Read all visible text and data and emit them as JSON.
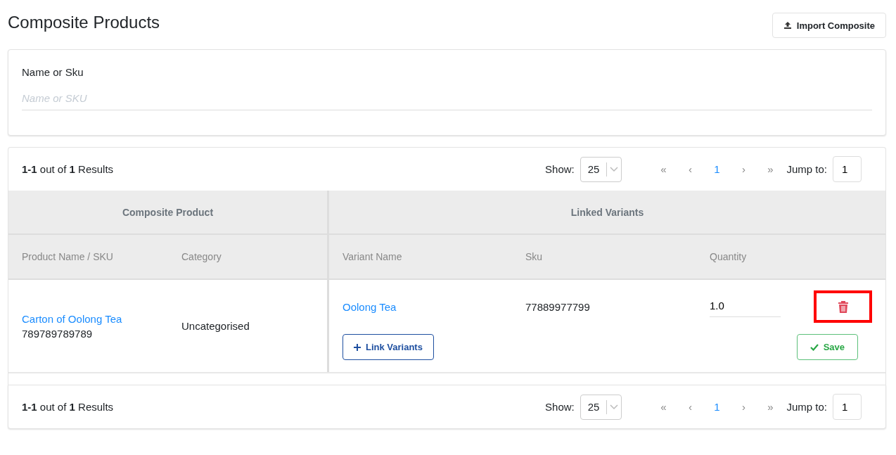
{
  "page": {
    "title": "Composite Products",
    "import_button": "Import Composite"
  },
  "filter": {
    "label": "Name or Sku",
    "placeholder": "Name or SKU"
  },
  "pagination_top": {
    "summary": "**1-1** out of **1** Results",
    "show_label": "Show:",
    "page_size": "25",
    "pages": [
      {
        "label": "«",
        "selected": false
      },
      {
        "label": "‹",
        "selected": false
      },
      {
        "label": "1",
        "selected": true
      },
      {
        "label": "›",
        "selected": false
      },
      {
        "label": "»",
        "selected": false
      }
    ],
    "jump_label": "Jump to:",
    "jump_value": "1"
  },
  "table": {
    "groups": [
      "Composite Product",
      "Linked Variants"
    ],
    "columns": [
      "Product Name / SKU",
      "Category",
      "Variant Name",
      "Sku",
      "Quantity"
    ],
    "rows": [
      {
        "product_name": "Carton of Oolong Tea",
        "product_sku": "789789789789",
        "category": "Uncategorised",
        "variants": [
          {
            "name": "Oolong Tea",
            "sku": "77889977799",
            "quantity": "1.0",
            "delete_highlighted": true
          }
        ],
        "link_button": "Link Variants",
        "save_button": "Save"
      }
    ]
  },
  "pagination_bottom": {
    "summary": "**1-1** out of **1** Results",
    "show_label": "Show:",
    "page_size": "25",
    "pages": [
      {
        "label": "«",
        "selected": false
      },
      {
        "label": "‹",
        "selected": false
      },
      {
        "label": "1",
        "selected": true
      },
      {
        "label": "›",
        "selected": false
      },
      {
        "label": "»",
        "selected": false
      }
    ],
    "jump_label": "Jump to:",
    "jump_value": "1"
  }
}
